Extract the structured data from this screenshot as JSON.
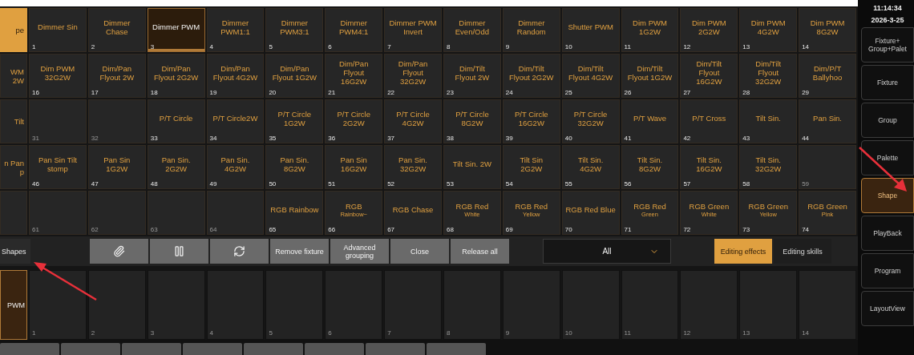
{
  "grid": {
    "rows": [
      {
        "edge": {
          "label": "pe",
          "kind": "group",
          "selected": true
        },
        "cells": [
          {
            "number": "1",
            "label": "Dimmer Sin",
            "selected": false
          },
          {
            "number": "2",
            "label": "Dimmer\nChase",
            "selected": false
          },
          {
            "number": "3",
            "label": "Dimmer PWM",
            "selected": true
          },
          {
            "number": "4",
            "label": "Dimmer\nPWM1:1",
            "selected": false
          },
          {
            "number": "5",
            "label": "Dimmer\nPWM3:1",
            "selected": false
          },
          {
            "number": "6",
            "label": "Dimmer\nPWM4:1",
            "selected": false
          },
          {
            "number": "7",
            "label": "Dimmer PWM\nInvert",
            "selected": false
          },
          {
            "number": "8",
            "label": "Dimmer\nEven/Odd",
            "selected": false
          },
          {
            "number": "9",
            "label": "Dimmer\nRandom",
            "selected": false
          },
          {
            "number": "10",
            "label": "Shutter PWM",
            "selected": false
          },
          {
            "number": "11",
            "label": "Dim PWM\n1G2W",
            "selected": false
          },
          {
            "number": "12",
            "label": "Dim PWM\n2G2W",
            "selected": false
          },
          {
            "number": "13",
            "label": "Dim PWM\n4G2W",
            "selected": false
          },
          {
            "number": "14",
            "label": "Dim PWM\n8G2W",
            "selected": false
          }
        ]
      },
      {
        "edge": {
          "label": "WM\n2W",
          "kind": "effect",
          "selected": false
        },
        "cells": [
          {
            "number": "16",
            "label": "Dim PWM\n32G2W",
            "selected": false
          },
          {
            "number": "17",
            "label": "Dim/Pan\nFlyout 2W",
            "selected": false
          },
          {
            "number": "18",
            "label": "Dim/Pan\nFlyout 2G2W",
            "selected": false
          },
          {
            "number": "19",
            "label": "Dim/Pan\nFlyout 4G2W",
            "selected": false
          },
          {
            "number": "20",
            "label": "Dim/Pan\nFlyout 1G2W",
            "selected": false
          },
          {
            "number": "21",
            "label": "Dim/Pan\nFlyout\n16G2W",
            "selected": false
          },
          {
            "number": "22",
            "label": "Dim/Pan\nFlyout\n32G2W",
            "selected": false
          },
          {
            "number": "23",
            "label": "Dim/Tilt\nFlyout 2W",
            "selected": false
          },
          {
            "number": "24",
            "label": "Dim/Tilt\nFlyout 2G2W",
            "selected": false
          },
          {
            "number": "25",
            "label": "Dim/Tilt\nFlyout 4G2W",
            "selected": false
          },
          {
            "number": "26",
            "label": "Dim/Tilt\nFlyout 1G2W",
            "selected": false
          },
          {
            "number": "27",
            "label": "Dim/Tilt\nFlyout\n16G2W",
            "selected": false
          },
          {
            "number": "28",
            "label": "Dim/Tilt\nFlyout\n32G2W",
            "selected": false
          },
          {
            "number": "29",
            "label": "Dim/P/T\nBallyhoo",
            "selected": false
          }
        ]
      },
      {
        "edge": {
          "label": "Tilt",
          "kind": "effect",
          "selected": false
        },
        "cells": [
          {
            "number": "31",
            "selected": false
          },
          {
            "number": "32",
            "selected": false
          },
          {
            "number": "33",
            "label": "P/T Circle",
            "selected": false
          },
          {
            "number": "34",
            "label": "P/T Circle2W",
            "selected": false
          },
          {
            "number": "35",
            "label": "P/T Circle\n1G2W",
            "selected": false
          },
          {
            "number": "36",
            "label": "P/T Circle\n2G2W",
            "selected": false
          },
          {
            "number": "37",
            "label": "P/T Circle\n4G2W",
            "selected": false
          },
          {
            "number": "38",
            "label": "P/T Circle\n8G2W",
            "selected": false
          },
          {
            "number": "39",
            "label": "P/T Circle\n16G2W",
            "selected": false
          },
          {
            "number": "40",
            "label": "P/T Circle\n32G2W",
            "selected": false
          },
          {
            "number": "41",
            "label": "P/T Wave",
            "selected": false
          },
          {
            "number": "42",
            "label": "P/T Cross",
            "selected": false
          },
          {
            "number": "43",
            "label": "Tilt Sin.",
            "selected": false
          },
          {
            "number": "44",
            "label": "Pan Sin.",
            "selected": false
          }
        ]
      },
      {
        "edge": {
          "label": "n Pan\np",
          "kind": "effect",
          "selected": false
        },
        "cells": [
          {
            "number": "46",
            "label": "Pan Sin Tilt\nstomp",
            "selected": false
          },
          {
            "number": "47",
            "label": "Pan Sin\n1G2W",
            "selected": false
          },
          {
            "number": "48",
            "label": "Pan Sin.\n2G2W",
            "selected": false
          },
          {
            "number": "49",
            "label": "Pan Sin.\n4G2W",
            "selected": false
          },
          {
            "number": "50",
            "label": "Pan Sin.\n8G2W",
            "selected": false
          },
          {
            "number": "51",
            "label": "Pan Sin\n16G2W",
            "selected": false
          },
          {
            "number": "52",
            "label": "Pan Sin.\n32G2W",
            "selected": false
          },
          {
            "number": "53",
            "label": "Tilt Sin. 2W",
            "selected": false
          },
          {
            "number": "54",
            "label": "Tilt Sin\n2G2W",
            "selected": false
          },
          {
            "number": "55",
            "label": "Tilt Sin.\n4G2W",
            "selected": false
          },
          {
            "number": "56",
            "label": "Tilt Sin.\n8G2W",
            "selected": false
          },
          {
            "number": "57",
            "label": "Tilt Sin.\n16G2W",
            "selected": false
          },
          {
            "number": "58",
            "label": "Tilt Sin.\n32G2W",
            "selected": false
          },
          {
            "number": "59",
            "selected": false
          }
        ]
      },
      {
        "edge": {
          "kind": "effect",
          "selected": false
        },
        "cells": [
          {
            "number": "61",
            "selected": false
          },
          {
            "number": "62",
            "selected": false
          },
          {
            "number": "63",
            "selected": false
          },
          {
            "number": "64",
            "selected": false
          },
          {
            "number": "65",
            "label": "RGB Rainbow",
            "selected": false
          },
          {
            "number": "66",
            "label": "RGB",
            "sublabel": "Rainbow~",
            "selected": false
          },
          {
            "number": "67",
            "label": "RGB Chase",
            "selected": false
          },
          {
            "number": "68",
            "label": "RGB Red",
            "sublabel": "White",
            "selected": false
          },
          {
            "number": "69",
            "label": "RGB Red",
            "sublabel": "Yellow",
            "selected": false
          },
          {
            "number": "70",
            "label": "RGB Red Blue",
            "selected": false
          },
          {
            "number": "71",
            "label": "RGB Red",
            "sublabel": "Green",
            "selected": false
          },
          {
            "number": "72",
            "label": "RGB Green",
            "sublabel": "White",
            "selected": false
          },
          {
            "number": "73",
            "label": "RGB Green",
            "sublabel": "Yellow",
            "selected": false
          },
          {
            "number": "74",
            "label": "RGB Green",
            "sublabel": "Pink",
            "selected": false
          }
        ]
      }
    ]
  },
  "toolbar": {
    "section_label": "Shapes",
    "actions": [
      {
        "kind": "icon"
      },
      {
        "kind": "icon"
      },
      {
        "kind": "icon"
      },
      {
        "kind": "text",
        "label": "Remove fixture"
      },
      {
        "kind": "text",
        "label": "Advanced\ngrouping"
      },
      {
        "kind": "text",
        "label": "Close"
      },
      {
        "kind": "text",
        "label": "Release all"
      }
    ],
    "filter": {
      "value": "All"
    },
    "modes": [
      {
        "label": "Editing effects",
        "selected": true
      },
      {
        "label": "Editing skills",
        "selected": false
      }
    ]
  },
  "playback": {
    "edge": {
      "label": "PWM",
      "selected": true
    },
    "cells": [
      {
        "number": "1",
        "selected": false
      },
      {
        "number": "2",
        "selected": false
      },
      {
        "number": "3",
        "selected": false
      },
      {
        "number": "4",
        "selected": false
      },
      {
        "number": "5",
        "selected": false
      },
      {
        "number": "6",
        "selected": false
      },
      {
        "number": "7",
        "selected": false
      },
      {
        "number": "8",
        "selected": false
      },
      {
        "number": "9",
        "selected": false
      },
      {
        "number": "10",
        "selected": false
      },
      {
        "number": "11",
        "selected": false
      },
      {
        "number": "12",
        "selected": false
      },
      {
        "number": "13",
        "selected": false
      },
      {
        "number": "14",
        "selected": false
      }
    ]
  },
  "sidebar": {
    "time": "11:14:34",
    "date": "2026-3-25",
    "items": [
      {
        "label": "Fixture+\nGroup+Palet",
        "selected": false
      },
      {
        "label": "Fixture",
        "selected": false
      },
      {
        "label": "Group",
        "selected": false
      },
      {
        "label": "Palette",
        "selected": false
      },
      {
        "label": "Shape",
        "selected": true
      },
      {
        "label": "PlayBack",
        "selected": false
      },
      {
        "label": "Program",
        "selected": false
      },
      {
        "label": "LayoutView",
        "selected": false
      }
    ]
  }
}
